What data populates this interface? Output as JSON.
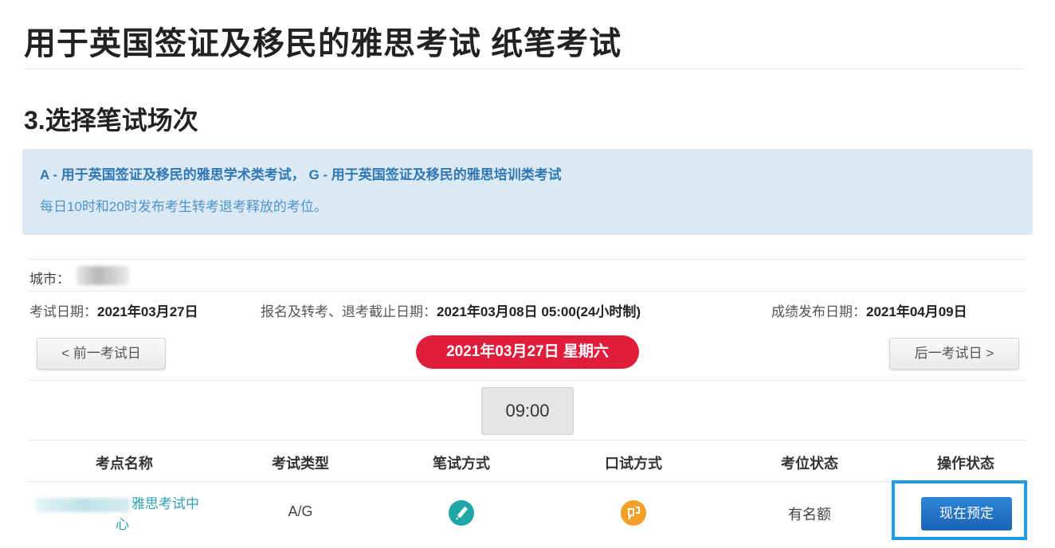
{
  "page": {
    "title": "用于英国签证及移民的雅思考试 纸笔考试",
    "section_title": "3.选择笔试场次"
  },
  "info": {
    "line1": "A - 用于英国签证及移民的雅思学术类考试， G - 用于英国签证及移民的雅思培训类考试",
    "line2": "每日10时和20时发布考生转考退考释放的考位。"
  },
  "city": {
    "label": "城市："
  },
  "dates": {
    "exam_label": "考试日期：",
    "exam_value": "2021年03月27日",
    "deadline_label": "报名及转考、退考截止日期：",
    "deadline_value": "2021年03月08日 05:00(24小时制)",
    "result_label": "成绩发布日期：",
    "result_value": "2021年04月09日"
  },
  "nav": {
    "prev": "< 前一考试日",
    "current": "2021年03月27日 星期六",
    "next": "后一考试日 >"
  },
  "time_slots": [
    "09:00"
  ],
  "table": {
    "headers": [
      "考点名称",
      "考试类型",
      "笔试方式",
      "口试方式",
      "考位状态",
      "操作状态"
    ],
    "rows": [
      {
        "name_suffix": "雅思考试中",
        "name_tail": "心",
        "type": "A/G",
        "written_icon": "pencil-icon",
        "speaking_icon": "speaking-icon",
        "status": "有名额",
        "action": "现在预定"
      }
    ]
  },
  "colors": {
    "accent_red": "#e01e3c",
    "info_bg": "#dbe9f5",
    "link_teal": "#2f9fb5",
    "pencil_icon": "#1fa7a7",
    "speaking_icon": "#f2a027",
    "book_button": "#1a63b6",
    "highlight_frame": "#1e9be6"
  }
}
